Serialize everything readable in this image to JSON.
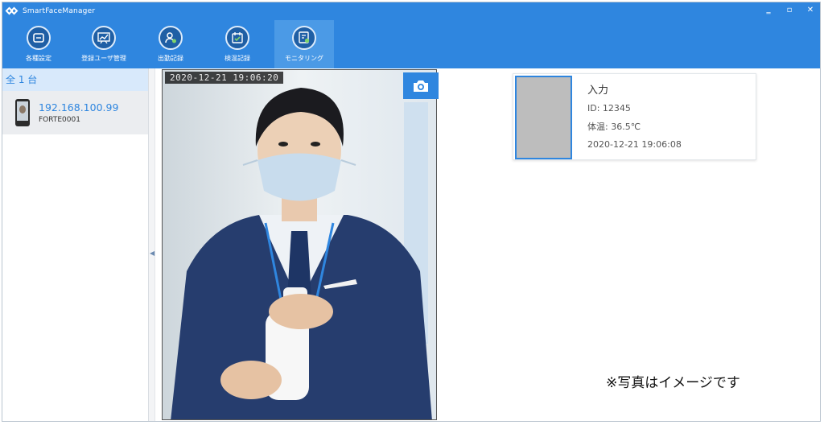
{
  "window": {
    "title": "SmartFaceManager",
    "controls": [
      "‗",
      "▫",
      "✕"
    ]
  },
  "toolbar": {
    "items": [
      {
        "label": "各種設定",
        "icon": "settings-home-icon"
      },
      {
        "label": "登録ユーザ管理",
        "icon": "user-management-chart-icon"
      },
      {
        "label": "出勤記録",
        "icon": "attendance-icon"
      },
      {
        "label": "検温記録",
        "icon": "temperature-record-icon"
      },
      {
        "label": "モニタリング",
        "icon": "monitoring-icon",
        "active": true
      }
    ]
  },
  "devices": {
    "summary": "全 1 台",
    "items": [
      {
        "ip": "192.168.100.99",
        "name": "FORTE0001"
      }
    ]
  },
  "camera": {
    "timestamp": "2020-12-21 19:06:20",
    "snapshot_icon": "camera-icon"
  },
  "detection": {
    "direction": "入力",
    "id": "ID: 12345",
    "temperature": "体温: 36.5℃",
    "time": "2020-12-21 19:06:08"
  },
  "note": "※写真はイメージです",
  "colors": {
    "accent": "#2f86df",
    "active_tab": "#4b9ae6"
  }
}
